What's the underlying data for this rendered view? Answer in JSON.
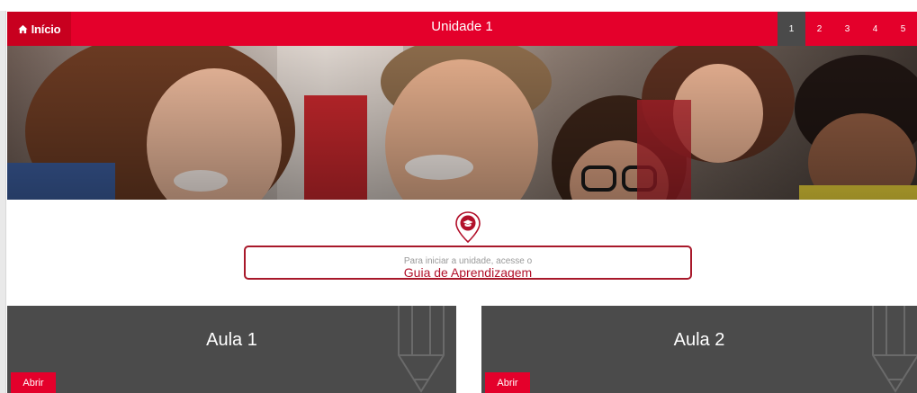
{
  "header": {
    "home_label": "Início",
    "unit_title": "Unidade 1",
    "pages": [
      "1",
      "2",
      "3",
      "4",
      "5"
    ],
    "active_page": "1"
  },
  "guide": {
    "intro": "Para iniciar a unidade, acesse o",
    "link": "Guia de Aprendizagem",
    "icon": "graduation-cap-pin-icon"
  },
  "lessons": [
    {
      "title": "Aula 1",
      "button": "Abrir"
    },
    {
      "title": "Aula 2",
      "button": "Abrir"
    }
  ],
  "colors": {
    "primary": "#e4002b",
    "dark_panel": "#4b4b4b",
    "guide_border": "#a8182a"
  }
}
